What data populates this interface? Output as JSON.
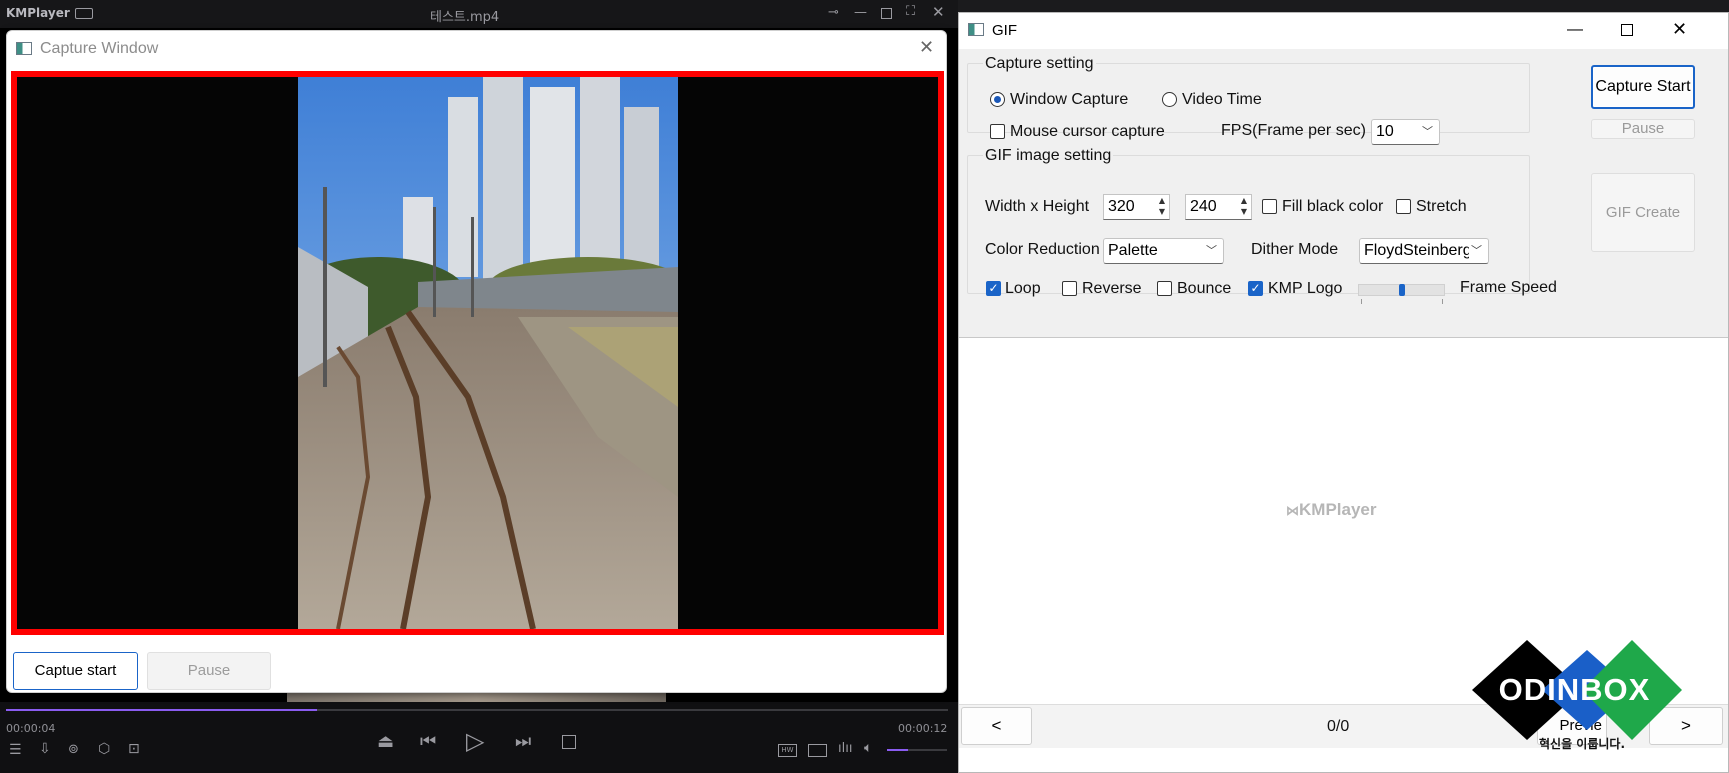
{
  "kmplayer": {
    "app_name": "KMPlayer",
    "file_title": "테스트.mp4",
    "time_elapsed": "00:00:04",
    "time_total": "00:00:12",
    "progress": 0.33,
    "volume": 0.35
  },
  "capture_window": {
    "title": "Capture Window",
    "start_label": "Captue start",
    "pause_label": "Pause"
  },
  "gif_window": {
    "title": "GIF",
    "capture_setting": {
      "legend": "Capture setting",
      "window_capture": "Window Capture",
      "video_time": "Video Time",
      "mouse_cursor": "Mouse cursor capture",
      "fps_label": "FPS(Frame per sec)",
      "fps_value": "10"
    },
    "gif_setting": {
      "legend": "GIF image setting",
      "size_label": "Width x Height",
      "width": "320",
      "height": "240",
      "fill_black": "Fill black color",
      "stretch": "Stretch",
      "color_reduction_label": "Color Reduction",
      "color_reduction_value": "Palette",
      "dither_label": "Dither Mode",
      "dither_value": "FloydSteinberg",
      "loop": "Loop",
      "reverse": "Reverse",
      "bounce": "Bounce",
      "kmp_logo": "KMP Logo",
      "frame_speed": "Frame Speed",
      "frame_speed_level": 0.5
    },
    "buttons": {
      "capture_start": "Capture Start",
      "pause": "Pause",
      "gif_create": "GIF Create",
      "prev": "<",
      "next": ">",
      "preview_partial": "Previe"
    },
    "watermark": "KMPlayer",
    "page_counter": "0/0"
  },
  "overlay_logo": {
    "brand": "ODINBOX",
    "tagline": "혁신을 이룹니다."
  },
  "colors": {
    "capture_border": "#ff0000",
    "accent": "#1a64c8",
    "km_progress": "#8a5cf0"
  }
}
